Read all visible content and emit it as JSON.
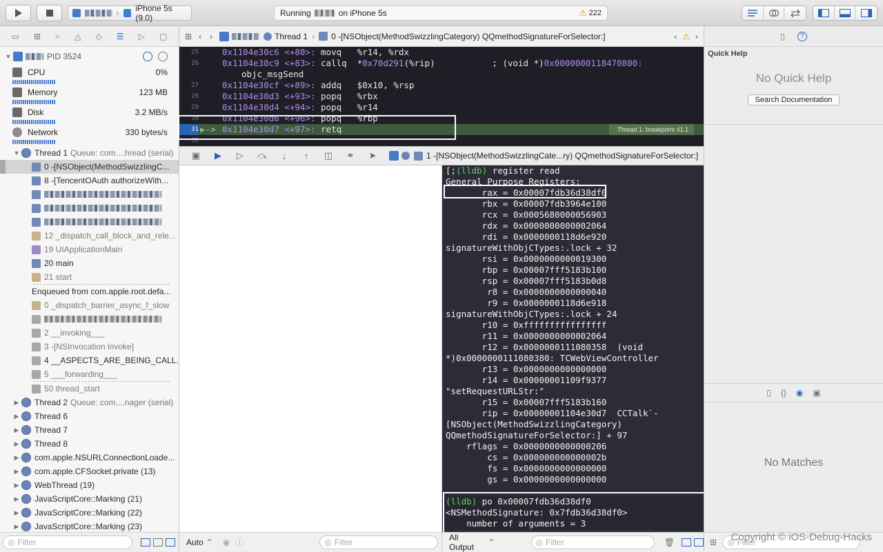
{
  "toolbar": {
    "scheme_device": "iPhone 5s (9.0)",
    "status_running": "Running",
    "status_on": "on iPhone 5s",
    "warning_count": "222"
  },
  "navigator": {
    "process": "PID 3524",
    "gauges": [
      {
        "label": "CPU",
        "value": "0%"
      },
      {
        "label": "Memory",
        "value": "123 MB"
      },
      {
        "label": "Disk",
        "value": "3.2 MB/s"
      },
      {
        "label": "Network",
        "value": "330 bytes/s"
      }
    ],
    "thread1": {
      "name": "Thread 1",
      "queue": "Queue: com....hread (serial)"
    },
    "frames": [
      {
        "text": "0 -[NSObject(MethodSwizzlingC...",
        "kind": "blue",
        "selected": true
      },
      {
        "text": "8 -[TencentOAuth authorizeWith...",
        "kind": "blue"
      },
      {
        "text": "",
        "kind": "blue",
        "blur": true
      },
      {
        "text": "",
        "kind": "blue",
        "blur": true
      },
      {
        "text": "",
        "kind": "blue",
        "blur": true
      },
      {
        "text": "12 _dispatch_call_block_and_rele...",
        "kind": "tan",
        "dim": true
      },
      {
        "text": "19 UIApplicationMain",
        "kind": "purple",
        "dim": true
      },
      {
        "text": "20 main",
        "kind": "blue"
      },
      {
        "text": "21 start",
        "kind": "tan",
        "dim": true
      }
    ],
    "enqueued": "Enqueued from com.apple.root.defa...",
    "enqueued_frames": [
      {
        "text": "0 _dispatch_barrier_async_f_slow",
        "kind": "tan",
        "dim": true
      },
      {
        "text": "",
        "kind": "gray",
        "blur": true
      },
      {
        "text": "2 __invoking___",
        "kind": "gray",
        "dim": true
      },
      {
        "text": "3 -[NSInvocation invoke]",
        "kind": "gray",
        "dim": true
      },
      {
        "text": "4 __ASPECTS_ARE_BEING_CALL...",
        "kind": "gray"
      },
      {
        "text": "5 ___forwarding___",
        "kind": "gray",
        "dim": true
      },
      {
        "text": "50 thread_start",
        "kind": "gray",
        "dim": true
      }
    ],
    "threads": [
      {
        "name": "Thread 2",
        "queue": "Queue: com....nager (serial)"
      },
      {
        "name": "Thread 6",
        "queue": ""
      },
      {
        "name": "Thread 7",
        "queue": ""
      },
      {
        "name": "Thread 8",
        "queue": ""
      },
      {
        "name": "com.apple.NSURLConnectionLoade...",
        "queue": ""
      },
      {
        "name": "com.apple.CFSocket.private (13)",
        "queue": ""
      },
      {
        "name": "WebThread (19)",
        "queue": ""
      },
      {
        "name": "JavaScriptCore::Marking (21)",
        "queue": ""
      },
      {
        "name": "JavaScriptCore::Marking (22)",
        "queue": ""
      },
      {
        "name": "JavaScriptCore::Marking (23)",
        "queue": ""
      }
    ],
    "filter_placeholder": "Filter"
  },
  "editor": {
    "jump_thread": "Thread 1",
    "jump_frame": "0 -[NSObject(MethodSwizzlingCategory) QQmethodSignatureForSelector:]",
    "lines": [
      {
        "n": "25",
        "addr": "0x1104e30c6",
        "off": "<+80>:",
        "code": "movq   %r14, %rdx",
        "comment": ""
      },
      {
        "n": "26",
        "addr": "0x1104e30c9",
        "off": "<+83>:",
        "code": "callq  *",
        "code2": "0x70d291",
        "code3": "(%rip)           ; (void *)",
        "comment": "0x0000000118470800:"
      },
      {
        "n": "",
        "addr": "",
        "off": "",
        "code": "objc_msgSend",
        "comment": ""
      },
      {
        "n": "27",
        "addr": "0x1104e30cf",
        "off": "<+89>:",
        "code": "addq   $0x10, %rsp",
        "comment": ""
      },
      {
        "n": "28",
        "addr": "0x1104e30d3",
        "off": "<+93>:",
        "code": "popq   %rbx",
        "comment": ""
      },
      {
        "n": "29",
        "addr": "0x1104e30d4",
        "off": "<+94>:",
        "code": "popq   %r14",
        "comment": ""
      },
      {
        "n": "30",
        "addr": "0x1104e30d6",
        "off": "<+96>:",
        "code": "popq   %rbp",
        "comment": ""
      },
      {
        "n": "31",
        "addr": "0x1104e30d7",
        "off": "<+97>:",
        "code": "retq",
        "comment": ""
      },
      {
        "n": "32",
        "addr": "",
        "off": "",
        "code": "",
        "comment": ""
      }
    ],
    "current_marker": "->",
    "breakpoint_label": "Thread 1: breakpoint 41.1"
  },
  "debugbar": {
    "frame": "1 -[NSObject(MethodSwizzlingCate...ry) QQmethodSignatureForSelector:]"
  },
  "variables": {
    "auto_label": "Auto",
    "filter_placeholder": "Filter"
  },
  "console": {
    "lines": [
      "[;(lldb) register read",
      "General Purpose Registers:",
      "       rax = 0x00007fdb36d38df0",
      "       rbx = 0x00007fdb3964e100",
      "       rcx = 0x0005680000056903",
      "       rdx = 0x0000000000002064",
      "       rdi = 0x0000000118d6e920",
      "signatureWithObjCTypes:.lock + 32",
      "       rsi = 0x0000000000019300",
      "       rbp = 0x00007fff5183b100",
      "       rsp = 0x00007fff5183b0d8",
      "        r8 = 0x0000000000000040",
      "        r9 = 0x0000000118d6e918",
      "signatureWithObjCTypes:.lock + 24",
      "       r10 = 0xffffffffffffffff",
      "       r11 = 0x0000000000002064",
      "       r12 = 0x0000000111080358  (void",
      "*)0x0000000111080380: TCWebViewController",
      "       r13 = 0x0000000000000000",
      "       r14 = 0x00000001109f9377",
      "\"setRequestURLStr:\"",
      "       r15 = 0x00007fff5183b160",
      "       rip = 0x00000001104e30d7  CCTalk`-",
      "[NSObject(MethodSwizzlingCategory)",
      "QQmethodSignatureForSelector:] + 97",
      "    rflags = 0x0000000000000206",
      "        cs = 0x000000000000002b",
      "        fs = 0x0000000000000000",
      "        gs = 0x0000000000000000",
      "",
      "(lldb) po 0x00007fdb36d38df0",
      "<NSMethodSignature: 0x7fdb36d38df0>",
      "    number of arguments = 3"
    ],
    "output_select": "All Output",
    "filter_placeholder": "Filter"
  },
  "inspector": {
    "quick_help_title": "Quick Help",
    "no_quick_help": "No Quick Help",
    "search_docs": "Search Documentation",
    "no_matches": "No Matches",
    "filter_placeholder": "Filter"
  },
  "watermark": "Copyright © iOS-Debug-Hacks",
  "colors": {
    "accent": "#2a63b4",
    "current_line": "#3e5c3c",
    "console_bg": "#2b2c36",
    "prompt": "#5fd35f"
  }
}
